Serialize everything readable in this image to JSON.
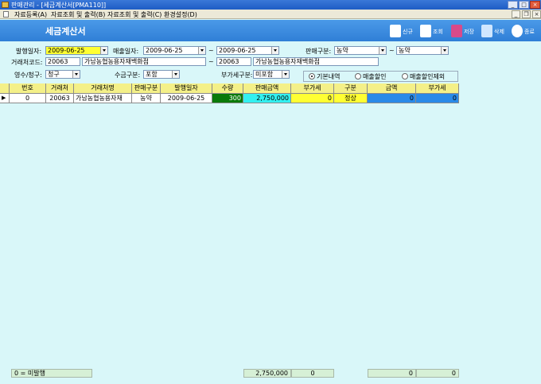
{
  "window": {
    "title": "판매관리 - [세금계산서[PMA110]]"
  },
  "menu": [
    "자료등록(A)",
    "자료조회 및 출력(B)",
    "자료조회 및 출력(C)",
    "환경설정(D)"
  ],
  "header": {
    "title": "세금계산서",
    "toolbar": [
      {
        "label": "신규",
        "icon": "new-doc-icon"
      },
      {
        "label": "조회",
        "icon": "search-doc-icon"
      },
      {
        "label": "저장",
        "icon": "save-icon"
      },
      {
        "label": "삭제",
        "icon": "trash-icon"
      },
      {
        "label": "종료",
        "icon": "power-icon"
      }
    ]
  },
  "filters": {
    "issue_date_label": "발행일자:",
    "issue_date": "2009-06-25",
    "sales_date_label": "매출일자:",
    "sales_date_from": "2009-06-25",
    "sales_date_to": "2009-06-25",
    "range_sep": "~",
    "sale_type_label": "판매구분:",
    "sale_type_from": "농약",
    "sale_type_to": "농약",
    "customer_code_label": "거래처코드:",
    "customer_code_from": "20063",
    "customer_name_from": "가남농협농용자재백화점",
    "customer_code_to": "20063",
    "customer_name_to": "가남농협농용자재백화점",
    "receipt_label": "영수/청구:",
    "receipt_value": "청구",
    "collect_label": "수금구분:",
    "collect_value": "포함",
    "vat_label": "부가세구분:",
    "vat_value": "미포함",
    "radio_options": [
      "기본내역",
      "매출할인",
      "매출할인제외"
    ],
    "radio_selected": 0
  },
  "grid": {
    "columns": [
      "번호",
      "거래처",
      "거래처명",
      "판매구분",
      "발행일자",
      "수량",
      "판매금액",
      "부가세",
      "구분",
      "금액",
      "부가세"
    ],
    "row_marker": "▶",
    "rows": [
      [
        "0",
        "20063",
        "가남농협농용자재",
        "농약",
        "2009-06-25",
        "300",
        "2,750,000",
        "0",
        "정상",
        "0",
        "0"
      ]
    ]
  },
  "footer": {
    "legend": "0 = 미발행",
    "total_sales": "2,750,000",
    "total_vat": "0",
    "total_amount": "0",
    "total_vat2": "0"
  },
  "colors": {
    "header_bg": "#3a8ae0",
    "qty_cell": "#0a7a0a",
    "sales_cell": "#33f0f0",
    "vat_cell": "#ffff33",
    "type_cell": "#ffff33",
    "amount_cell": "#2a8ae8",
    "vat2_cell": "#2a8ae8"
  }
}
